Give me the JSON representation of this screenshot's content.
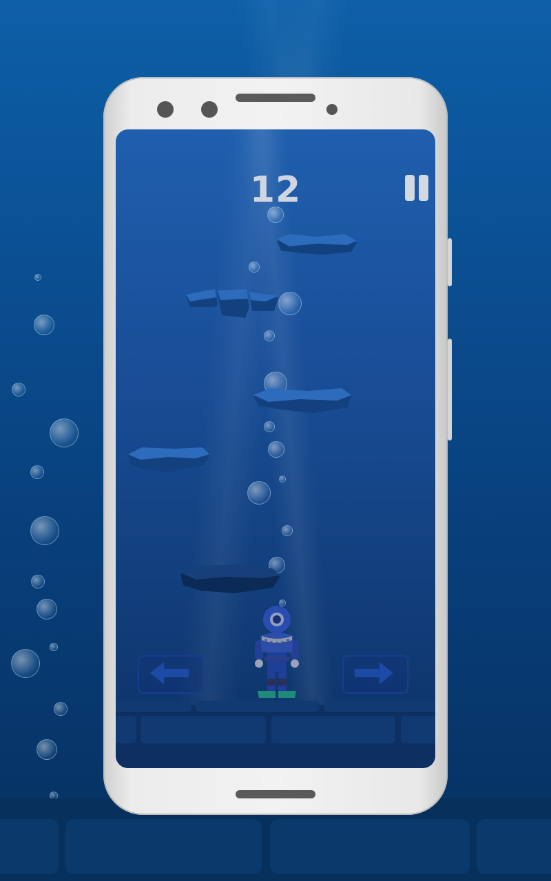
{
  "game": {
    "score": "12",
    "pause_icon": "pause-icon",
    "left_icon": "arrow-left-icon",
    "right_icon": "arrow-right-icon",
    "character": "diver"
  },
  "colors": {
    "background": "#0b4f92",
    "screen_top": "#1f5fae",
    "screen_bottom": "#0d3266",
    "platform": "#2a66b4",
    "score_text": "#cfd6e2",
    "phone_frame": "#ececec"
  }
}
